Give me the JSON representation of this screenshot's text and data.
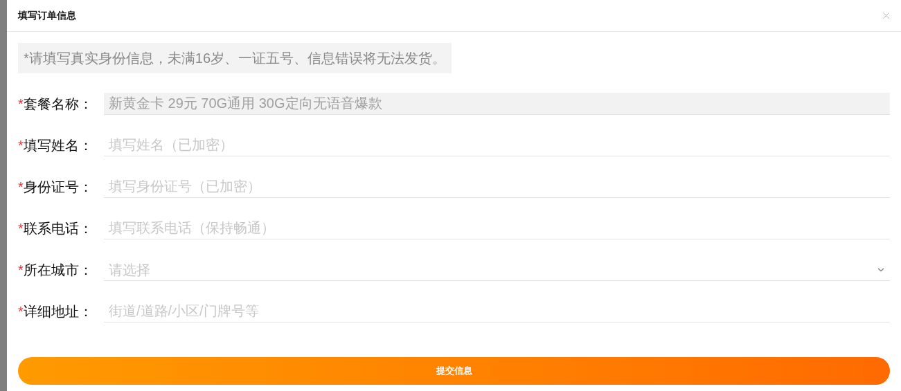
{
  "dialog": {
    "title": "填写订单信息"
  },
  "notice": "*请填写真实身份信息，未满16岁、一证五号、信息错误将无法发货。",
  "fields": [
    {
      "kind": "text",
      "label": "套餐名称：",
      "required": true,
      "value": "新黄金卡 29元 70G通用 30G定向无语音爆款",
      "disabled": true
    },
    {
      "kind": "text",
      "label": "填写姓名：",
      "required": true,
      "placeholder": "填写姓名（已加密）"
    },
    {
      "kind": "text",
      "label": "身份证号：",
      "required": true,
      "placeholder": "填写身份证号（已加密）"
    },
    {
      "kind": "text",
      "label": "联系电话：",
      "required": true,
      "placeholder": "填写联系电话（保持畅通）"
    },
    {
      "kind": "select",
      "label": "所在城市：",
      "required": true,
      "placeholder": "请选择"
    },
    {
      "kind": "text",
      "label": "详细地址：",
      "required": true,
      "placeholder": "街道/道路/小区/门牌号等"
    }
  ],
  "required_mark": "*",
  "submit": {
    "label": "提交信息"
  }
}
